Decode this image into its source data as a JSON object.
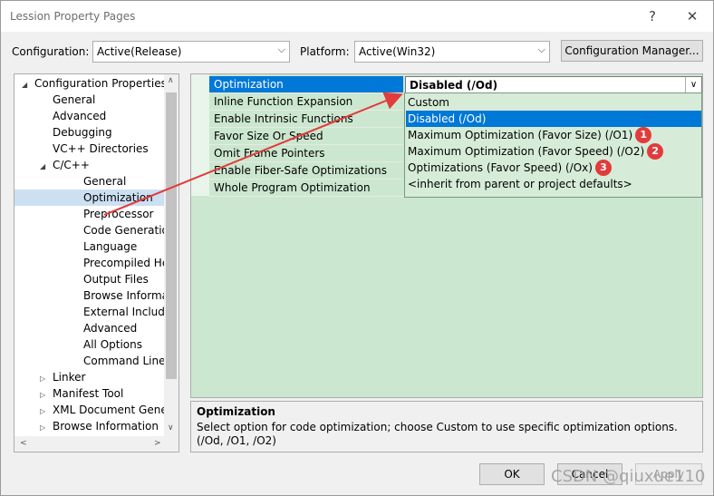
{
  "window": {
    "title": "Lession Property Pages",
    "help_glyph": "?",
    "close_glyph": "✕"
  },
  "config": {
    "configuration_label": "Configuration:",
    "configuration_value": "Active(Release)",
    "platform_label": "Platform:",
    "platform_value": "Active(Win32)",
    "manager_button": "Configuration Manager..."
  },
  "tree": {
    "items": [
      {
        "label": "Configuration Properties",
        "expander": "◢",
        "level": 1
      },
      {
        "label": "General",
        "level": 2
      },
      {
        "label": "Advanced",
        "level": 2
      },
      {
        "label": "Debugging",
        "level": 2
      },
      {
        "label": "VC++ Directories",
        "level": 2
      },
      {
        "label": "C/C++",
        "expander": "◢",
        "level": 2
      },
      {
        "label": "General",
        "level": 3
      },
      {
        "label": "Optimization",
        "level": 3,
        "selected": true
      },
      {
        "label": "Preprocessor",
        "level": 3
      },
      {
        "label": "Code Generation",
        "level": 3
      },
      {
        "label": "Language",
        "level": 3
      },
      {
        "label": "Precompiled Heade",
        "level": 3
      },
      {
        "label": "Output Files",
        "level": 3
      },
      {
        "label": "Browse Information",
        "level": 3
      },
      {
        "label": "External Includes",
        "level": 3
      },
      {
        "label": "Advanced",
        "level": 3
      },
      {
        "label": "All Options",
        "level": 3
      },
      {
        "label": "Command Line",
        "level": 3
      },
      {
        "label": "Linker",
        "expander": "▷",
        "level": 2
      },
      {
        "label": "Manifest Tool",
        "expander": "▷",
        "level": 2
      },
      {
        "label": "XML Document Genera",
        "expander": "▷",
        "level": 2
      },
      {
        "label": "Browse Information",
        "expander": "▷",
        "level": 2
      }
    ]
  },
  "properties": {
    "rows": [
      {
        "label": "Optimization",
        "selected": true
      },
      {
        "label": "Inline Function Expansion"
      },
      {
        "label": "Enable Intrinsic Functions"
      },
      {
        "label": "Favor Size Or Speed"
      },
      {
        "label": "Omit Frame Pointers"
      },
      {
        "label": "Enable Fiber-Safe Optimizations"
      },
      {
        "label": "Whole Program Optimization"
      }
    ],
    "current_value": "Disabled (/Od)"
  },
  "dropdown": {
    "options": [
      {
        "label": "Custom"
      },
      {
        "label": "Disabled (/Od)",
        "selected": true
      },
      {
        "label": "Maximum Optimization (Favor Size) (/O1)",
        "badge": "1"
      },
      {
        "label": "Maximum Optimization (Favor Speed) (/O2)",
        "badge": "2"
      },
      {
        "label": "Optimizations (Favor Speed) (/Ox)",
        "badge": "3"
      },
      {
        "label": "<inherit from parent or project defaults>"
      }
    ]
  },
  "description": {
    "heading": "Optimization",
    "text": "Select option for code optimization; choose Custom to use specific optimization options.     (/Od, /O1, /O2)"
  },
  "buttons": {
    "ok": "OK",
    "cancel": "Cancel",
    "apply": "Apply"
  },
  "watermark": "CSDN @qiuxue110",
  "colors": {
    "accent": "#0078d7",
    "grid_bg": "#cce7cf",
    "badge": "#e23b3b",
    "arrow": "#e23b3b"
  }
}
